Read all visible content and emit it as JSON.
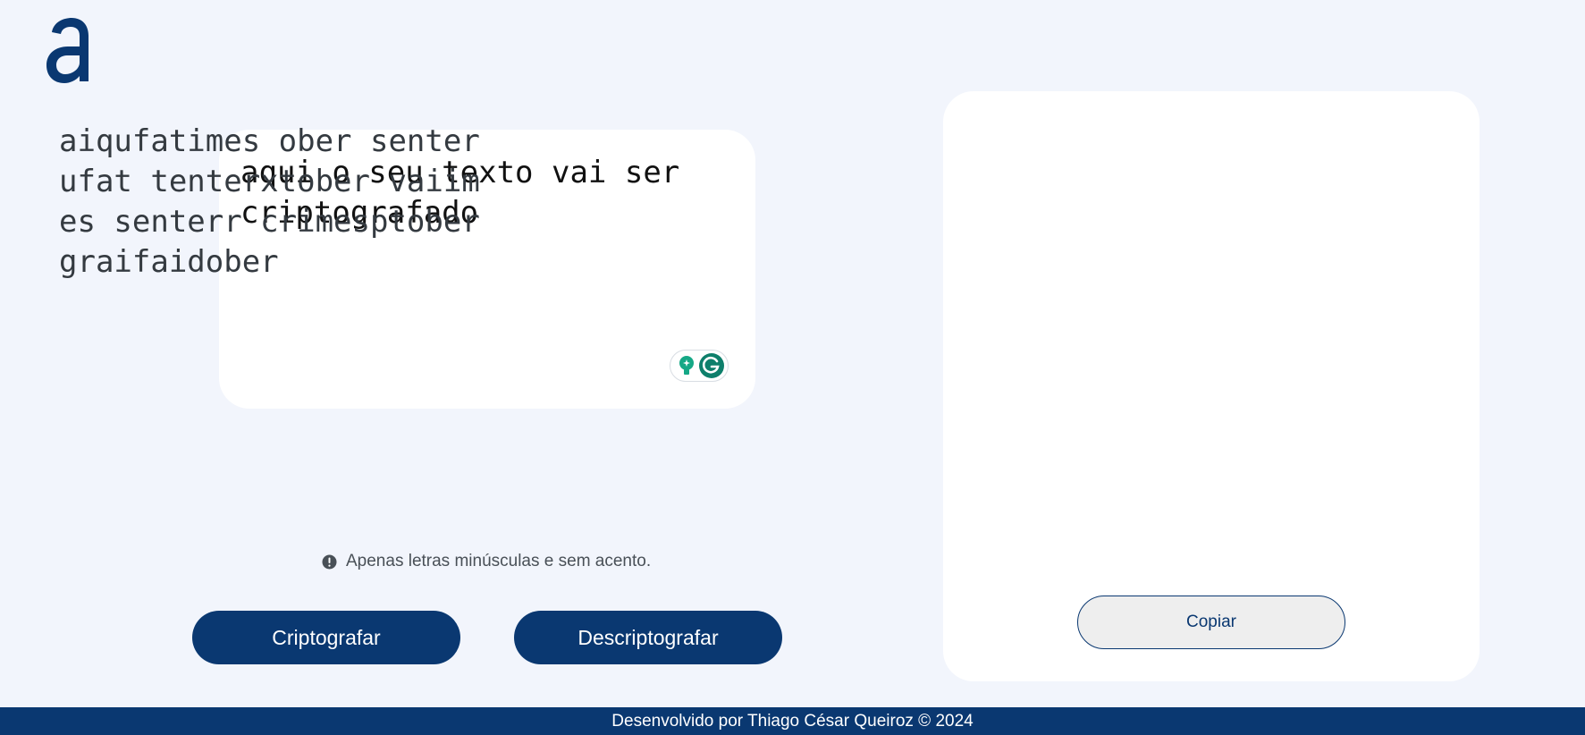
{
  "logo": {
    "icon": "alura-logo-icon",
    "color": "#0a3871"
  },
  "input": {
    "value": "aqui o seu texto vai ser criptografado",
    "grammarly_icons": [
      "lightbulb-icon",
      "grammarly-icon"
    ]
  },
  "warning": {
    "icon": "exclamation-circle-icon",
    "text": "Apenas letras minúsculas e sem acento."
  },
  "buttons": {
    "encrypt_label": "Criptografar",
    "decrypt_label": "Descriptografar",
    "copy_label": "Copiar"
  },
  "output": {
    "value": "aiqufatimes ober senterufat tenterxtober vaiimes senterr crimesptobergraifaidober"
  },
  "footer": {
    "text": "Desenvolvido por Thiago César Queiroz © 2024"
  },
  "colors": {
    "background": "#f2f5fc",
    "primary": "#0a3871",
    "card": "#ffffff",
    "grammarly_green": "#15a886"
  }
}
